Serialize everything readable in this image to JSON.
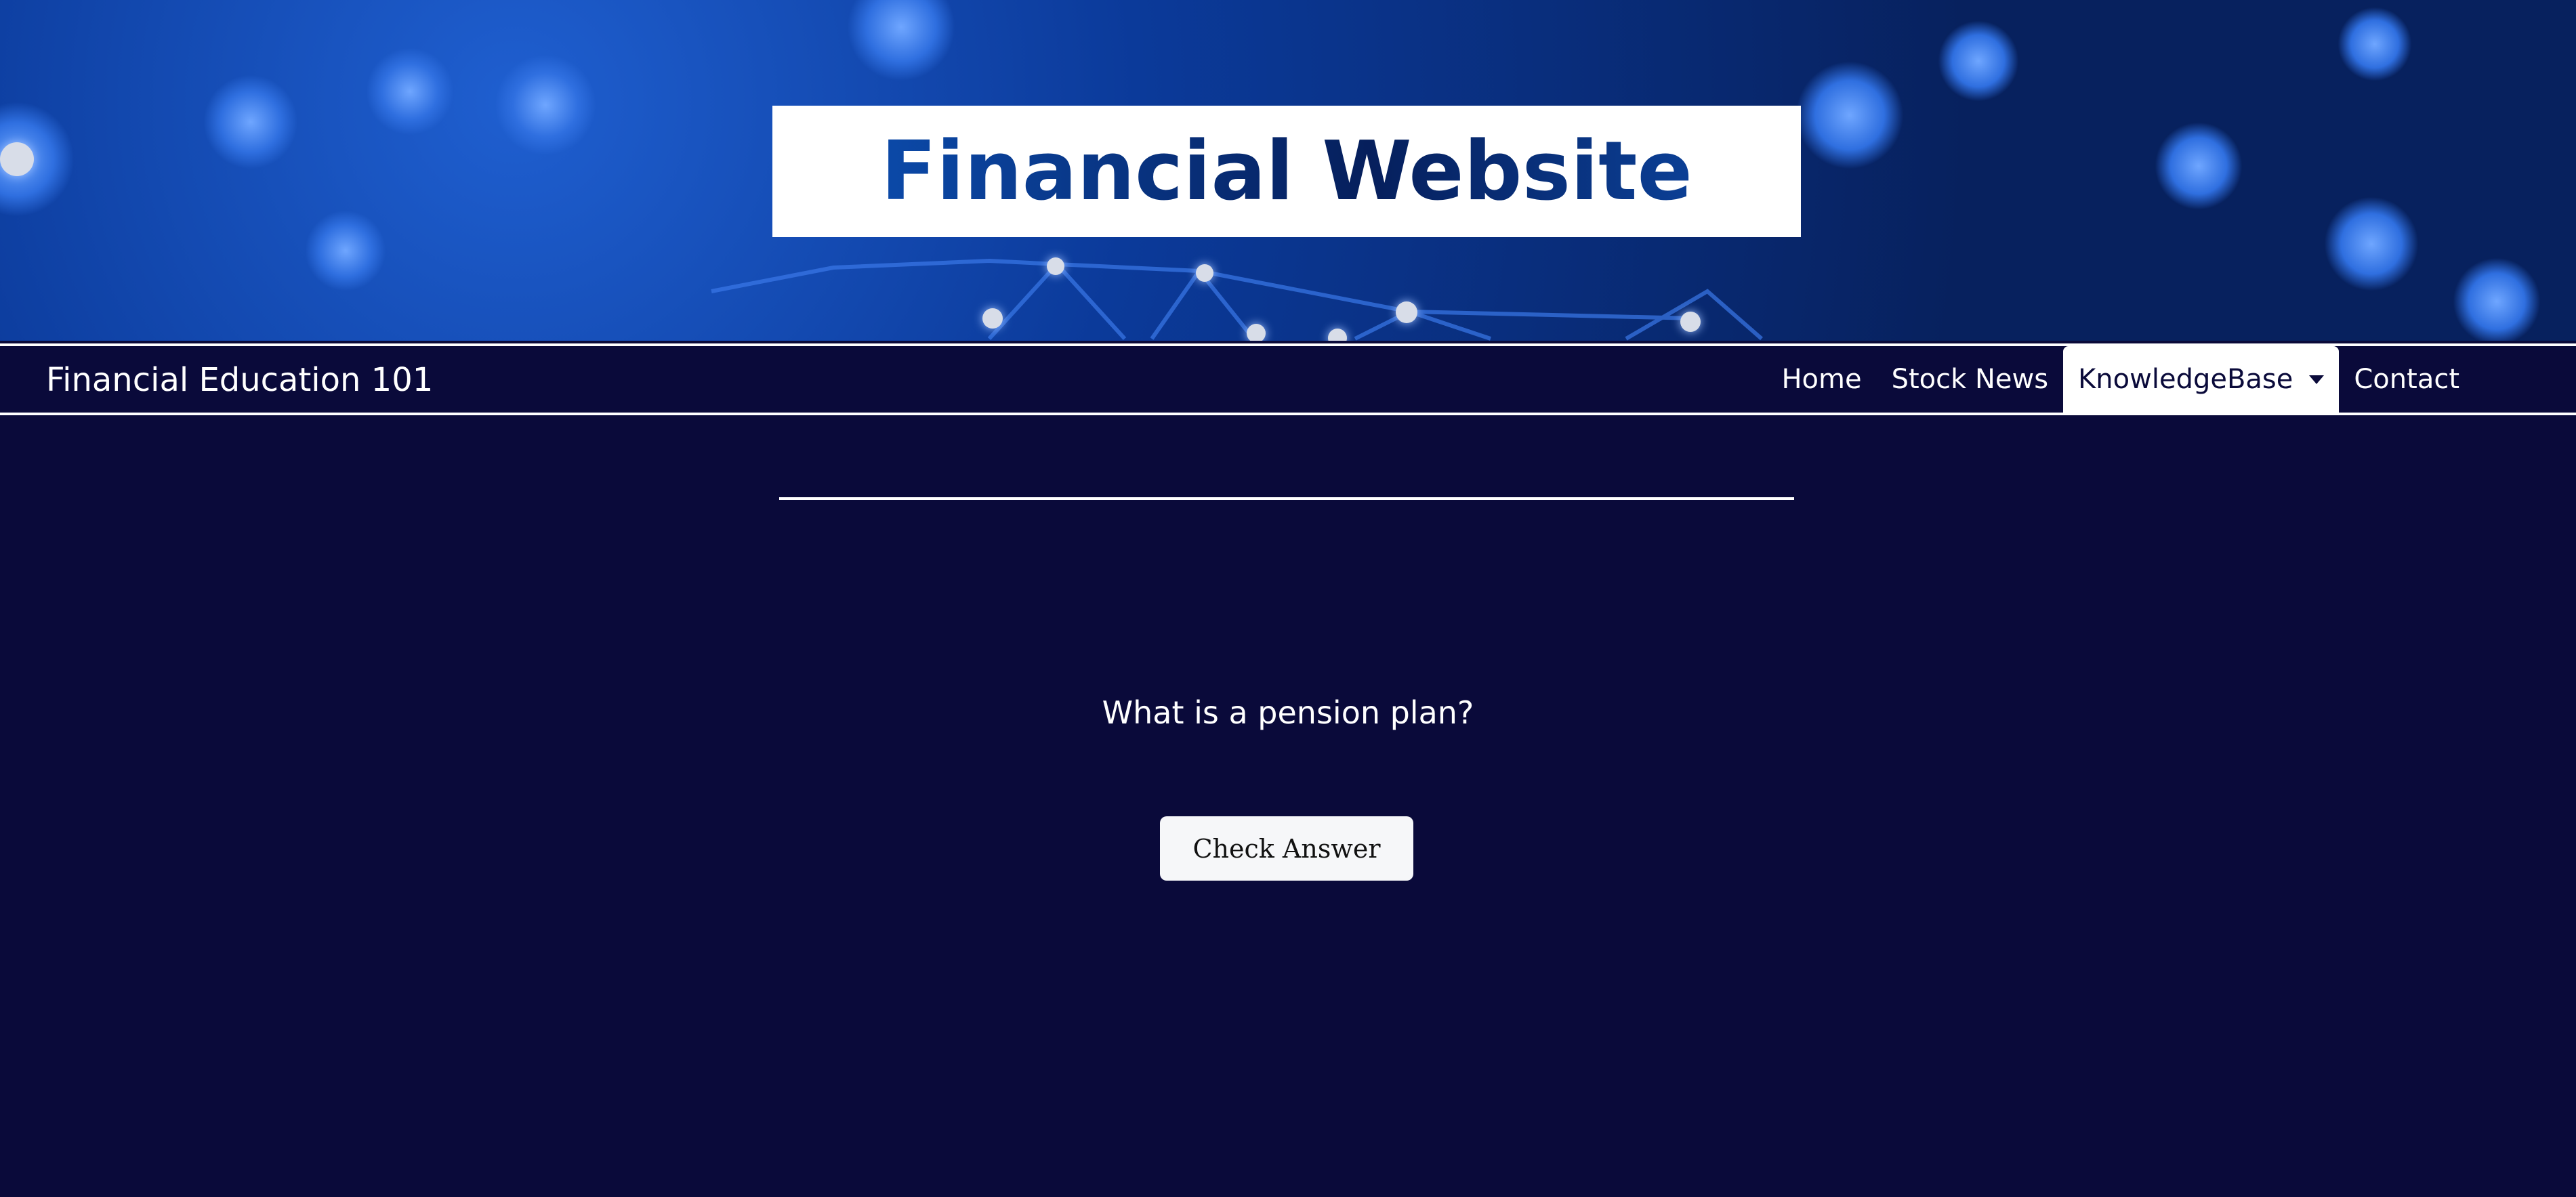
{
  "header": {
    "title": "Financial Website"
  },
  "nav": {
    "brand": "Financial Education 101",
    "items": [
      {
        "label": "Home"
      },
      {
        "label": "Stock News"
      },
      {
        "label": "KnowledgeBase",
        "active": true
      },
      {
        "label": "Contact"
      }
    ]
  },
  "main": {
    "question": "What is a pension plan?",
    "check_button": "Check Answer"
  },
  "colors": {
    "background": "#0a0a3a",
    "title": "#0b3f95",
    "banner": "#0b3a9a"
  }
}
